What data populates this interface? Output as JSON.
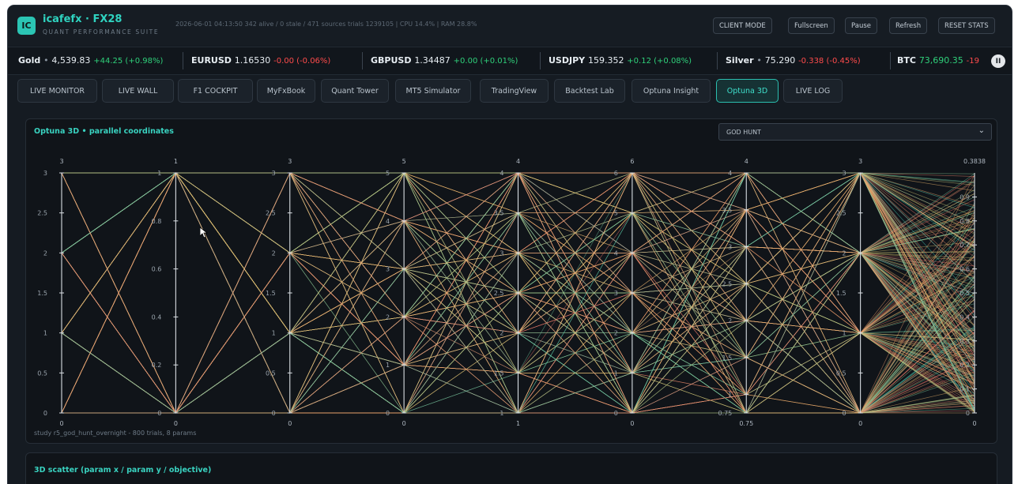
{
  "header": {
    "logo_text": "IC",
    "title": "icafefx · FX28",
    "subtitle": "QUANT PERFORMANCE SUITE",
    "status_line": "2026-06-01 04:13:50   342 alive / 0 stale / 471 sources   trials 1239105 | CPU 14.4% | RAM 28.8%",
    "buttons": [
      "CLIENT MODE",
      "Fullscreen",
      "Pause",
      "Refresh",
      "RESET STATS"
    ]
  },
  "ticker": [
    {
      "symbol": "Gold",
      "dot": "•",
      "price": "4,539.83",
      "change": "+44.25 (+0.98%)",
      "dir": "up"
    },
    {
      "symbol": "EURUSD",
      "dot": "",
      "price": "1.16530",
      "change": "-0.00 (-0.06%)",
      "dir": "down"
    },
    {
      "symbol": "GBPUSD",
      "dot": "",
      "price": "1.34487",
      "change": "+0.00 (+0.01%)",
      "dir": "up"
    },
    {
      "symbol": "USDJPY",
      "dot": "",
      "price": "159.352",
      "change": "+0.12 (+0.08%)",
      "dir": "up"
    },
    {
      "symbol": "Silver",
      "dot": "•",
      "price": "75.290",
      "change": "-0.338 (-0.45%)",
      "dir": "down"
    },
    {
      "symbol": "BTC",
      "dot": "",
      "price": "73,690.35",
      "change": "-19",
      "dir": "down"
    }
  ],
  "ticker_pause_icon": "II",
  "tabs": [
    {
      "label": "LIVE MONITOR",
      "active": false
    },
    {
      "label": "LIVE WALL",
      "active": false
    },
    {
      "label": "F1 COCKPIT",
      "active": false
    },
    {
      "label": "MyFxBook",
      "active": false
    },
    {
      "label": "Quant Tower",
      "active": false
    },
    {
      "label": "MT5 Simulator",
      "active": false
    },
    {
      "label": "TradingView",
      "active": false
    },
    {
      "label": "Backtest Lab",
      "active": false
    },
    {
      "label": "Optuna Insight",
      "active": false
    },
    {
      "label": "Optuna 3D",
      "active": true
    },
    {
      "label": "LIVE LOG",
      "active": false
    }
  ],
  "parallel_panel": {
    "title": "Optuna 3D • parallel coordinates",
    "select_value": "GOD HUNT",
    "footer": "study r5_god_hunt_overnight - 800 trials, 8 params"
  },
  "scatter_panel": {
    "title": "3D scatter (param x / param y / objective)"
  },
  "colors": {
    "accent": "#2bc5b4",
    "up": "#2fd07a",
    "down": "#ff4b4b",
    "line_low": "#35d1c2",
    "line_mid": "#e9c46a",
    "line_high": "#f06e6e"
  },
  "chart_data": {
    "type": "parallel_coordinates",
    "n_trials": 800,
    "axes": [
      {
        "max_label": "3",
        "min_label": "0",
        "ticks": [
          "0",
          "0.5",
          "1",
          "1.5",
          "2",
          "2.5",
          "3"
        ],
        "range": [
          0,
          3
        ],
        "levels": [
          0,
          1,
          2,
          3
        ]
      },
      {
        "max_label": "1",
        "min_label": "0",
        "ticks": [
          "0",
          "0.2",
          "0.4",
          "0.6",
          "0.8",
          "1"
        ],
        "range": [
          0,
          1
        ],
        "levels": [
          0,
          1
        ]
      },
      {
        "max_label": "3",
        "min_label": "0",
        "ticks": [
          "0",
          "0.5",
          "1",
          "1.5",
          "2",
          "2.5",
          "3"
        ],
        "range": [
          0,
          3
        ],
        "levels": [
          0,
          1,
          2,
          3
        ]
      },
      {
        "max_label": "5",
        "min_label": "0",
        "ticks": [
          "0",
          "1",
          "2",
          "3",
          "4",
          "5"
        ],
        "range": [
          0,
          5
        ],
        "levels": [
          0,
          1,
          2,
          3,
          4,
          5
        ]
      },
      {
        "max_label": "4",
        "min_label": "1",
        "ticks": [
          "1",
          "1.5",
          "2",
          "2.5",
          "3",
          "3.5",
          "4"
        ],
        "range": [
          1,
          4
        ],
        "levels": [
          1,
          1.5,
          2,
          2.5,
          3,
          3.5,
          4
        ]
      },
      {
        "max_label": "6",
        "min_label": "0",
        "ticks": [
          "0",
          "1",
          "2",
          "3",
          "4",
          "5",
          "6"
        ],
        "range": [
          0,
          6
        ],
        "levels": [
          0,
          1,
          2,
          3,
          4,
          5,
          6
        ]
      },
      {
        "max_label": "4",
        "min_label": "0.75",
        "ticks": [
          "0.75",
          "1",
          "1.5",
          "2",
          "2.5",
          "3",
          "3.5",
          "4"
        ],
        "range": [
          0.75,
          4
        ],
        "levels": [
          0.75,
          1,
          1.5,
          2,
          2.5,
          3,
          3.5,
          4
        ]
      },
      {
        "max_label": "3",
        "min_label": "0",
        "ticks": [
          "0",
          "0.5",
          "1",
          "1.5",
          "2",
          "2.5",
          "3"
        ],
        "range": [
          0,
          3
        ],
        "levels": [
          0,
          1,
          2,
          3
        ]
      },
      {
        "max_label": "0.3838",
        "min_label": "0",
        "ticks": [
          "0",
          "0.1",
          "0.2",
          "0.3",
          "0.4",
          "0.5",
          "0.6",
          "0.7",
          "0.8",
          "0.9"
        ],
        "range": [
          0,
          1
        ],
        "continuous": true
      }
    ]
  }
}
